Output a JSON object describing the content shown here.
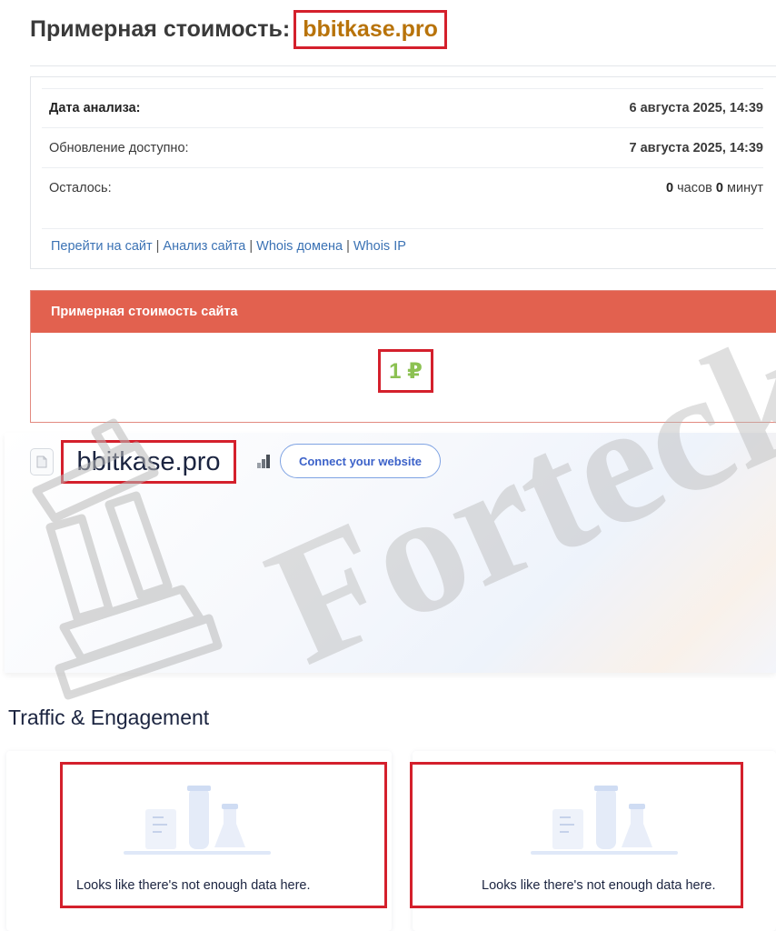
{
  "header": {
    "title_prefix": "Примерная стоимость:",
    "title_domain": "bbitkase.pro"
  },
  "analysis": {
    "rows": [
      {
        "label": "Дата анализа:",
        "value": "6 августа 2025, 14:39"
      },
      {
        "label": "Обновление доступно:",
        "value": "7 августа 2025, 14:39"
      }
    ],
    "remaining": {
      "label": "Осталось:",
      "hours": "0",
      "hours_unit": "часов",
      "minutes": "0",
      "minutes_unit": "минут"
    },
    "links": [
      "Перейти на сайт",
      "Анализ сайта",
      "Whois домена",
      "Whois IP"
    ],
    "link_separator": "|"
  },
  "price_card": {
    "header": "Примерная стоимость сайта",
    "value": "1 ₽"
  },
  "similarweb": {
    "domain": "bbitkase.pro",
    "connect_label": "Connect your website",
    "section_title": "Traffic & Engagement",
    "empty_message": "Looks like there's not enough data here."
  },
  "watermark": {
    "text": "Forteck"
  },
  "colors": {
    "accent_red": "#e2614f",
    "highlight_red": "#d4202c",
    "domain_orange": "#b8730a",
    "price_green": "#8cc152",
    "link_blue": "#3b72b4",
    "connect_blue": "#3c62c9"
  },
  "icons": {
    "doc": "document-icon",
    "bars": "bar-chart-icon",
    "illustration": "lab-flasks-illustration"
  }
}
